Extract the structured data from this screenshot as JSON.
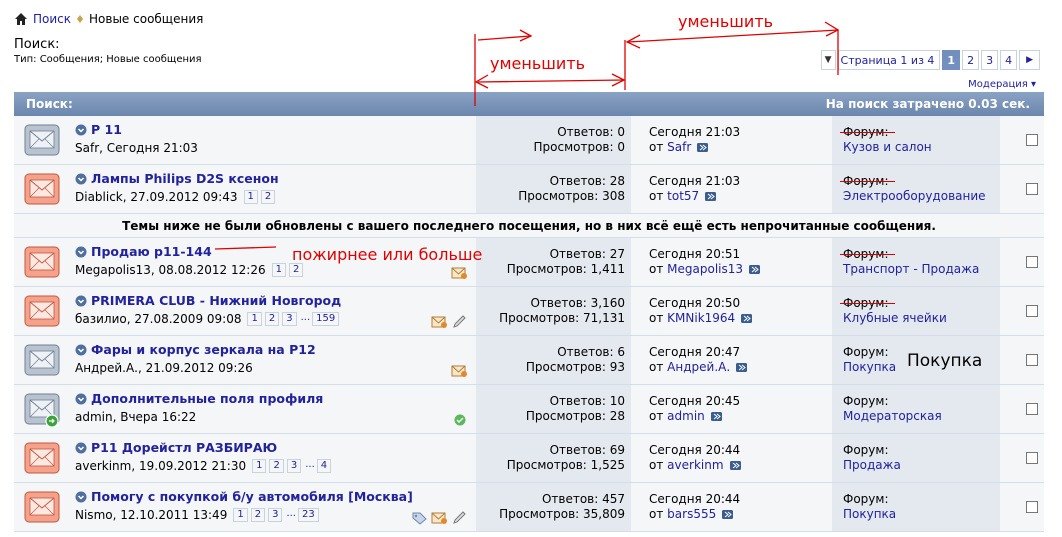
{
  "breadcrumb": {
    "home_link": "Поиск",
    "current": "Новые сообщения"
  },
  "header": {
    "title": "Поиск:",
    "subtitle": "Тип: Сообщения; Новые сообщения"
  },
  "pager": {
    "label": "Страница 1 из 4",
    "pages": [
      "1",
      "2",
      "3",
      "4"
    ],
    "current": "1"
  },
  "moderation": "Модерация",
  "table": {
    "title": "Поиск:",
    "time_note": "На поиск затрачено 0.03 сек."
  },
  "notice": "Темы ниже не были обновлены с вашего последнего посещения, но в них всё ещё есть непрочитанные сообщения.",
  "threads": [
    {
      "title": "P 11",
      "meta": "Safr, Сегодня 21:03",
      "pages": [],
      "replies": "Ответов: 0",
      "views": "Просмотров: 0",
      "last_time": "Сегодня 21:03",
      "last_by_prefix": "от",
      "last_by": "Safr",
      "forum_label": "Форум:",
      "forum": "Кузов и салон",
      "icon_color": "gray"
    },
    {
      "title": "Лампы Philips D2S ксенон",
      "meta": "Diablick, 27.09.2012 09:43",
      "pages": [
        "1",
        "2"
      ],
      "replies": "Ответов: 28",
      "views": "Просмотров: 308",
      "last_time": "Сегодня 21:03",
      "last_by_prefix": "от",
      "last_by": "tot57",
      "forum_label": "Форум:",
      "forum": "Электрооборудование",
      "icon_color": "red"
    },
    {
      "title": "Продаю p11-144",
      "meta": "Megapolis13, 08.08.2012 12:26",
      "pages": [
        "1",
        "2"
      ],
      "replies": "Ответов: 27",
      "views": "Просмотров: 1,411",
      "last_time": "Сегодня 20:51",
      "last_by_prefix": "от",
      "last_by": "Megapolis13",
      "forum_label": "Форум:",
      "forum": "Транспорт - Продажа",
      "icon_color": "red"
    },
    {
      "title": "PRIMERA CLUB - Нижний Новгород",
      "meta": "базилио, 27.08.2009 09:08",
      "pages": [
        "1",
        "2",
        "3",
        "...",
        "159"
      ],
      "replies": "Ответов: 3,160",
      "views": "Просмотров: 71,131",
      "last_time": "Сегодня 20:50",
      "last_by_prefix": "от",
      "last_by": "KMNik1964",
      "forum_label": "Форум:",
      "forum": "Клубные ячейки",
      "icon_color": "red"
    },
    {
      "title": "Фары и корпус зеркала на P12",
      "meta": "Андрей.А., 21.09.2012 09:26",
      "pages": [],
      "replies": "Ответов: 6",
      "views": "Просмотров: 93",
      "last_time": "Сегодня 20:47",
      "last_by_prefix": "от",
      "last_by": "Андрей.А.",
      "forum_label": "Форум:",
      "forum": "Покупка",
      "icon_color": "gray"
    },
    {
      "title": "Дополнительные поля профиля",
      "meta": "admin, Вчера 16:22",
      "pages": [],
      "replies": "Ответов: 10",
      "views": "Просмотров: 28",
      "last_time": "Сегодня 20:45",
      "last_by_prefix": "от",
      "last_by": "admin",
      "forum_label": "Форум:",
      "forum": "Модераторская",
      "icon_color": "gray"
    },
    {
      "title": "P11 Дорейстл РАЗБИРАЮ",
      "meta": "averkinm, 19.09.2012 21:30",
      "pages": [
        "1",
        "2",
        "3",
        "...",
        "4"
      ],
      "replies": "Ответов: 69",
      "views": "Просмотров: 1,525",
      "last_time": "Сегодня 20:44",
      "last_by_prefix": "от",
      "last_by": "averkinm",
      "forum_label": "Форум:",
      "forum": "Продажа",
      "icon_color": "red"
    },
    {
      "title": "Помогу с покупкой б/у автомобиля [Москва]",
      "meta": "Nismo, 12.10.2011 13:49",
      "pages": [
        "1",
        "2",
        "3",
        "...",
        "23"
      ],
      "replies": "Ответов: 457",
      "views": "Просмотров: 35,809",
      "last_time": "Сегодня 20:44",
      "last_by_prefix": "от",
      "last_by": "bars555",
      "forum_label": "Форум:",
      "forum": "Покупка",
      "icon_color": "red"
    }
  ],
  "annotations": {
    "reduce_1": "уменьшить",
    "reduce_2": "уменьшить",
    "bolder": "пожирнее или больше",
    "purchase": "Покупка"
  },
  "colors": {
    "header_bar": "#7a94b9",
    "link": "#22229c",
    "annotation": "#e00000",
    "stats_bg": "#e4e9f0",
    "row_bg": "#f5f6f8"
  }
}
